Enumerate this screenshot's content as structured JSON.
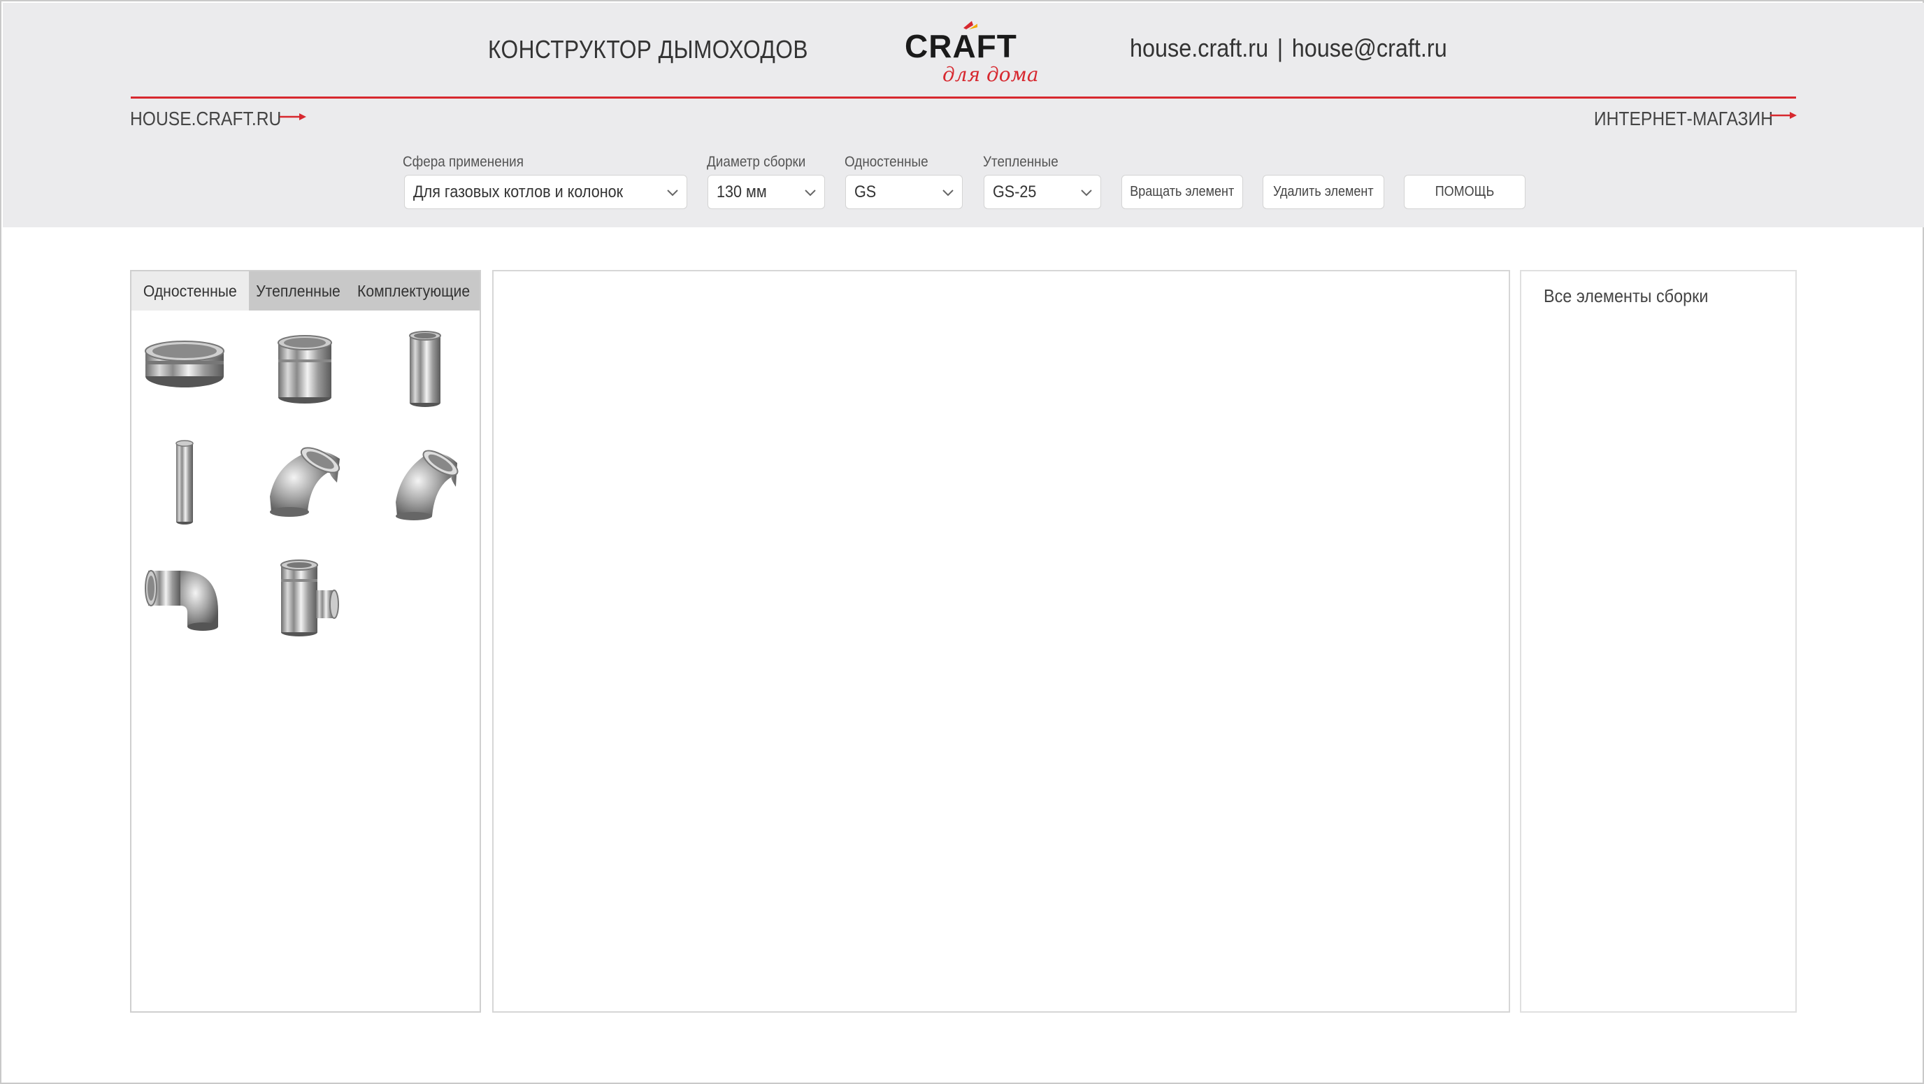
{
  "header": {
    "app_title": "КОНСТРУКТОР ДЫМОХОДОВ",
    "logo": {
      "brand": "CRÁFT",
      "tagline": "для дома",
      "icon": "craft-logo"
    },
    "contacts": {
      "site": "house.craft.ru",
      "separator": "|",
      "email": "house@craft.ru"
    },
    "nav_left": "HOUSE.CRAFT.RU",
    "nav_right": "ИНТЕРНЕТ-МАГАЗИН",
    "accent_color": "#d7282f"
  },
  "controls": {
    "application": {
      "label": "Сфера применения",
      "value": "Для газовых котлов и колонок"
    },
    "diameter": {
      "label": "Диаметр сборки",
      "value": "130 мм"
    },
    "single_wall": {
      "label": "Одностенные",
      "value": "GS"
    },
    "insulated": {
      "label": "Утепленные",
      "value": "GS-25"
    },
    "rotate_button": "Вращать элемент",
    "delete_button": "Удалить элемент",
    "help_button": "ПОМОЩЬ"
  },
  "palette": {
    "tabs": [
      {
        "label": "Одностенные",
        "active": true
      },
      {
        "label": "Утепленные",
        "active": false
      },
      {
        "label": "Комплектующие",
        "active": false
      }
    ],
    "elements": [
      {
        "icon": "adapter-ring-icon"
      },
      {
        "icon": "short-pipe-icon"
      },
      {
        "icon": "pipe-icon"
      },
      {
        "icon": "long-pipe-icon"
      },
      {
        "icon": "elbow-45-icon"
      },
      {
        "icon": "elbow-45-alt-icon"
      },
      {
        "icon": "elbow-90-icon"
      },
      {
        "icon": "tee-icon"
      }
    ]
  },
  "assembly": {
    "title": "Все элементы сборки"
  }
}
